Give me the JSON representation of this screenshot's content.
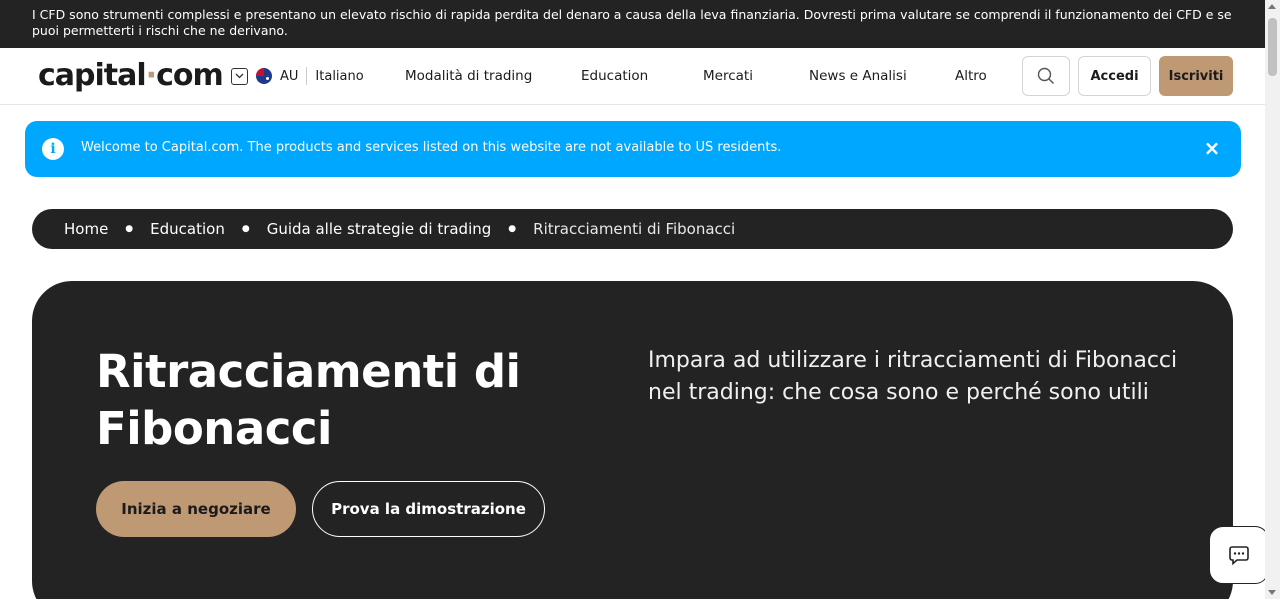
{
  "risk_warning": "I CFD sono strumenti complessi e presentano un elevato rischio di rapida perdita del denaro a causa della leva finanziaria. Dovresti prima valutare se comprendi il funzionamento dei CFD e se puoi permetterti i rischi che ne derivano.",
  "header": {
    "logo_left": "capital",
    "logo_right": "com",
    "region_code": "AU",
    "language": "Italiano",
    "nav": [
      "Modalità di trading",
      "Education",
      "Mercati",
      "News e Analisi",
      "Altro"
    ],
    "login_label": "Accedi",
    "signup_label": "Iscriviti"
  },
  "notice": {
    "message": "Welcome to Capital.com. The products and services listed on this website are not available to US residents."
  },
  "breadcrumb": [
    "Home",
    "Education",
    "Guida alle strategie di trading",
    "Ritracciamenti di Fibonacci"
  ],
  "hero": {
    "title": "Ritracciamenti di Fibonacci",
    "subtitle": "Impara ad utilizzare i ritracciamenti di Fibonacci nel trading: che cosa sono e perché sono utili",
    "cta_primary": "Inizia a negoziare",
    "cta_secondary": "Prova la dimostrazione"
  },
  "colors": {
    "accent": "#bf9874",
    "notice_bg": "#00a7ff",
    "dark": "#232323"
  },
  "icons": {
    "search": "search-icon",
    "info": "info-icon",
    "close": "close-icon",
    "chat": "chat-icon"
  }
}
